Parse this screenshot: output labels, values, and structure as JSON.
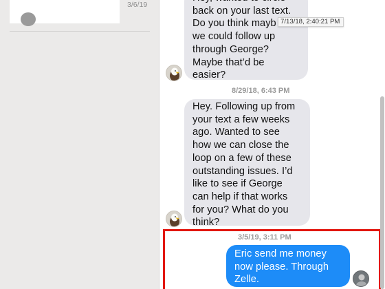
{
  "sidebar": {
    "conversations": [
      {
        "date": "3/6/19"
      }
    ]
  },
  "chat": {
    "messages": [
      {
        "direction": "incoming",
        "text": "Hey, wanted to circle\nback on your last text.\n Do you think mayb\nwe could follow up\nthrough George?\n Maybe that’d be\neasier?",
        "hover_timestamp": "7/13/18, 2:40:21 PM"
      },
      {
        "timestamp": "8/29/18, 6:43 PM",
        "direction": "incoming",
        "text": "Hey.  Following up from\nyour text a few weeks\nago.  Wanted to see\nhow we can close the\nloop on a few of these\noutstanding issues. I’d\n like to see if George\ncan help if that works\nfor you? What do you\nthink?"
      },
      {
        "timestamp": "3/5/19, 3:11 PM",
        "direction": "outgoing",
        "text": "Eric send me money\nnow please. Through\nZelle."
      }
    ]
  },
  "colors": {
    "outgoing_bubble": "#1d8cf8",
    "incoming_bubble": "#e6e6eb",
    "highlight_box": "#e2170f",
    "sidebar_bg": "#ebeae9"
  },
  "icons": {
    "contact_avatar": "eagle-avatar-icon",
    "sender_avatar": "user-photo-avatar-icon"
  }
}
